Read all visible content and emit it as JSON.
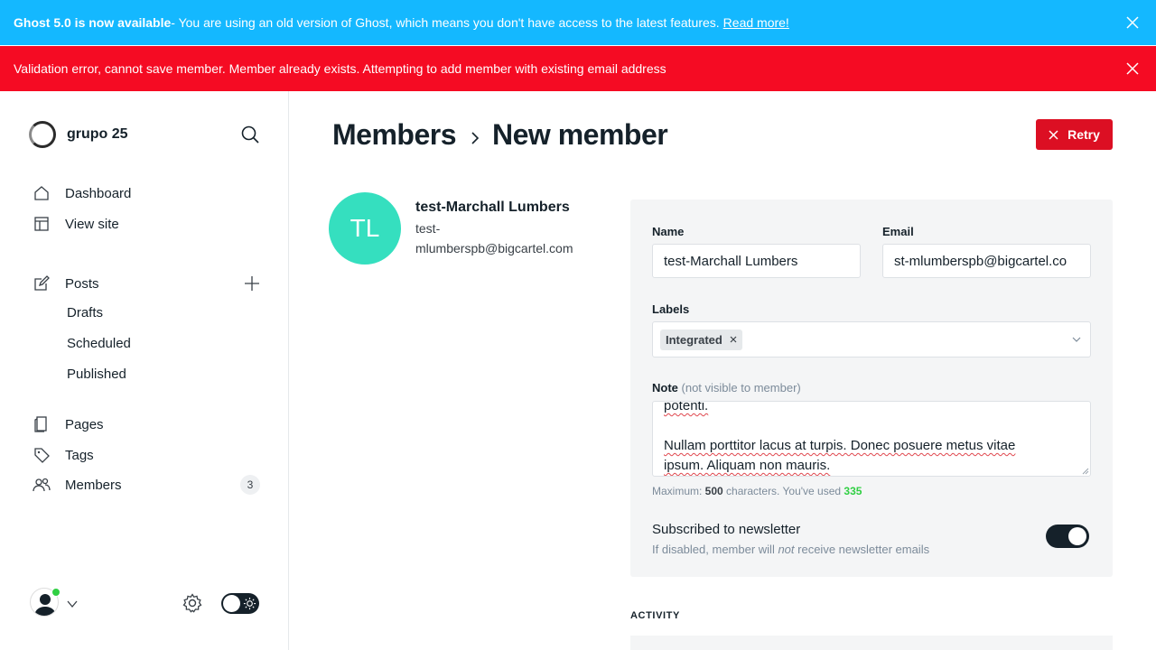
{
  "banners": {
    "upgrade": {
      "title": "Ghost 5.0 is now available",
      "message": " - You are using an old version of Ghost, which means you don't have access to the latest features.",
      "link": "Read more!"
    },
    "error": {
      "message": "Validation error, cannot save member. Member already exists. Attempting to add member with existing email address"
    }
  },
  "sidebar": {
    "site_name": "grupo 25",
    "nav": {
      "dashboard": "Dashboard",
      "view_site": "View site",
      "posts": "Posts",
      "drafts": "Drafts",
      "scheduled": "Scheduled",
      "published": "Published",
      "pages": "Pages",
      "tags": "Tags",
      "members": "Members",
      "members_count": "3"
    }
  },
  "header": {
    "crumb_parent": "Members",
    "crumb_current": "New member",
    "retry_label": "Retry"
  },
  "member": {
    "initials": "TL",
    "name": "test-Marchall Lumbers",
    "email_line1": "test-",
    "email_line2": "mlumberspb@bigcartel.com"
  },
  "form": {
    "name_label": "Name",
    "name_value": "test-Marchall Lumbers",
    "email_label": "Email",
    "email_value": "st-mlumberspb@bigcartel.co",
    "labels_label": "Labels",
    "labels_selected": "Integrated",
    "note_label": "Note",
    "note_hint": "(not visible to member)",
    "note_line1": "potenti.",
    "note_line2": "Nullam porttitor lacus at turpis. Donec posuere metus vitae",
    "note_line3": "ipsum. Aliquam non mauris.",
    "char_prefix": "Maximum: ",
    "char_max": "500",
    "char_mid": " characters. You've used ",
    "char_used": "335",
    "newsletter_title": "Subscribed to newsletter",
    "newsletter_sub_a": "If disabled, member will ",
    "newsletter_sub_em": "not",
    "newsletter_sub_b": " receive newsletter emails",
    "newsletter_enabled": true
  },
  "activity": {
    "heading": "ACTIVITY"
  },
  "colors": {
    "upgrade_banner": "#14b8ff",
    "error_banner": "#f50b23",
    "retry_button": "#dc0f23",
    "avatar_bg": "#35dfbf",
    "used_count": "#30cf43"
  }
}
